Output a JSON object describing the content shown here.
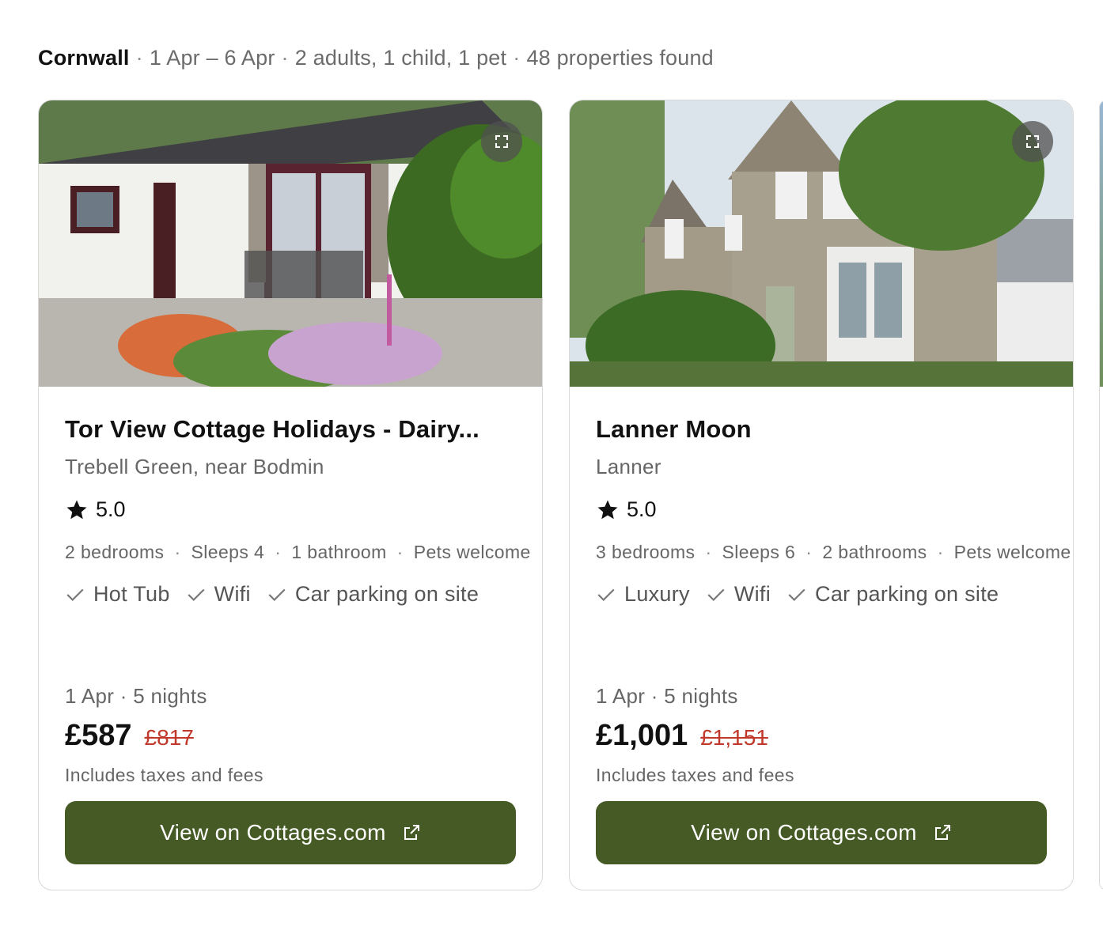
{
  "search_summary": {
    "location": "Cornwall",
    "dates": "1 Apr – 6 Apr",
    "guests": "2 adults, 1 child, 1 pet",
    "results": "48 properties found",
    "separator": "·"
  },
  "listings": [
    {
      "title": "Tor View Cottage Holidays - Dairy...",
      "location": "Trebell Green, near Bodmin",
      "rating": "5.0",
      "facts": [
        "2 bedrooms",
        "Sleeps 4",
        "1 bathroom",
        "Pets welcome"
      ],
      "features": [
        "Hot Tub",
        "Wifi",
        "Car parking on site"
      ],
      "dates": "1 Apr · 5 nights",
      "price": "£587",
      "old_price": "£817",
      "taxes_note": "Includes taxes and fees",
      "cta_label": "View on Cottages.com"
    },
    {
      "title": "Lanner Moon",
      "location": "Lanner",
      "rating": "5.0",
      "facts": [
        "3 bedrooms",
        "Sleeps 6",
        "2 bathrooms",
        "Pets welcome"
      ],
      "features": [
        "Luxury",
        "Wifi",
        "Car parking on site"
      ],
      "dates": "1 Apr · 5 nights",
      "price": "£1,001",
      "old_price": "£1,151",
      "taxes_note": "Includes taxes and fees",
      "cta_label": "View on Cottages.com"
    }
  ],
  "icons": {
    "expand": "expand-icon",
    "star": "star-icon",
    "check": "check-icon",
    "external": "external-link-icon"
  },
  "colors": {
    "cta_bg": "#455a24",
    "old_price": "#c0392b"
  }
}
